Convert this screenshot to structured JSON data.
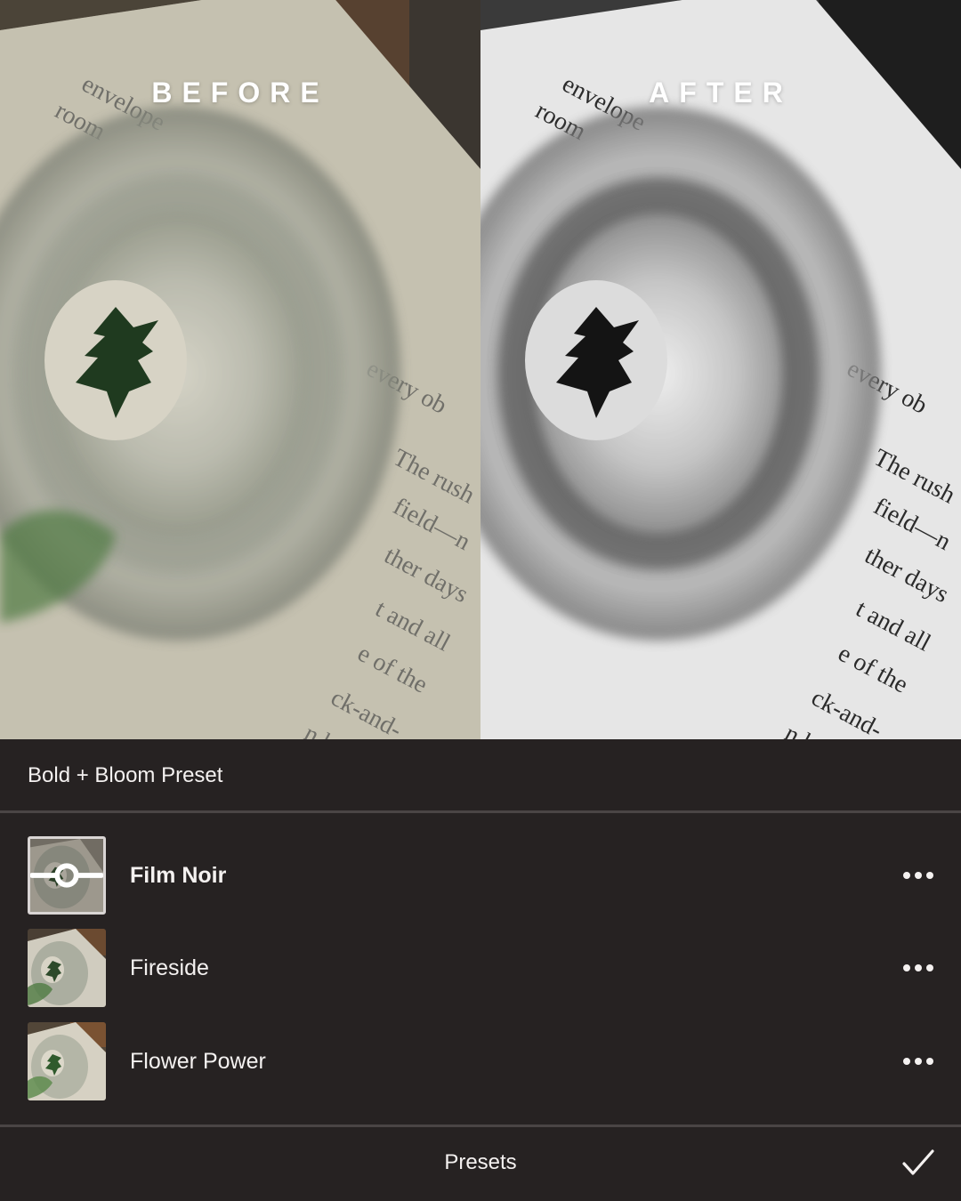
{
  "comparison": {
    "before_label": "BEFORE",
    "after_label": "AFTER"
  },
  "header": {
    "title": "Bold + Bloom Preset"
  },
  "presets": [
    {
      "name": "Film Noir",
      "selected": true
    },
    {
      "name": "Fireside",
      "selected": false
    },
    {
      "name": "Flower Power",
      "selected": false
    }
  ],
  "footer": {
    "title": "Presets"
  },
  "icons": {
    "more": "more-horizontal-icon",
    "confirm": "checkmark-icon",
    "adjust": "slider-adjust-icon"
  },
  "colors": {
    "panel_background": "#262222",
    "divider": "#4a4545",
    "text": "#f4f1f0"
  }
}
